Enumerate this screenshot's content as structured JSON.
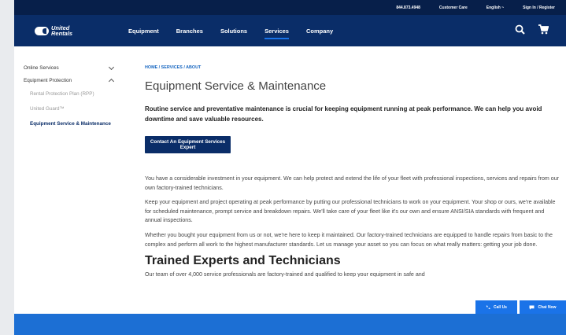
{
  "utility": {
    "phone": "844.873.4948",
    "customer_care": "Customer Care",
    "language": "English ~",
    "sign_in": "Sign In / Register"
  },
  "nav": {
    "logo_line1": "United",
    "logo_line2": "Rentals",
    "links": [
      "Equipment",
      "Branches",
      "Solutions",
      "Services",
      "Company"
    ],
    "active": "Services"
  },
  "sidebar": {
    "items": [
      {
        "label": "Online Services"
      },
      {
        "label": "Equipment Protection"
      }
    ],
    "subitems": [
      {
        "label": "Rental Protection Plan (RPP)"
      },
      {
        "label": "United Guard™"
      },
      {
        "label": "Equipment Service & Maintenance"
      }
    ]
  },
  "main": {
    "breadcrumb": "HOME / SERVICES / ABOUT",
    "title": "Equipment Service & Maintenance",
    "lead": "Routine service and preventative maintenance is crucial for keeping equipment running at peak performance. We can help you avoid downtime and save valuable resources.",
    "cta": "Contact An Equipment Services Expert",
    "paragraphs": [
      "You have a considerable investment in your equipment. We can help protect and extend the life of your fleet with professional inspections, services and repairs from our own factory-trained technicians.",
      "Keep your equipment and project operating at peak performance by putting our professional technicians to work on your equipment. Your shop or ours, we're available for scheduled maintenance, prompt service and breakdown repairs. We'll take care of your fleet like it's our own and ensure ANSI/SIA standards with frequent and annual inspections.",
      "Whether you bought your equipment from us or not, we're here to keep it maintained. Our factory-trained technicians are equipped to handle repairs from basic to the complex and perform all work to the highest manufacturer standards. Let us manage your asset so you can focus on what really matters: getting your job done."
    ],
    "section_heading": "Trained Experts and Technicians",
    "cut_text": "Our team of over 4,000 service professionals are factory-trained and qualified to keep your equipment in safe and"
  },
  "floating": {
    "call": "Call Us",
    "chat": "Chat Now"
  },
  "colors": {
    "nav_bg": "#0a2d68",
    "utility_bg": "#071f4a",
    "accent": "#1a73e8",
    "footer": "#1c6fd4"
  }
}
